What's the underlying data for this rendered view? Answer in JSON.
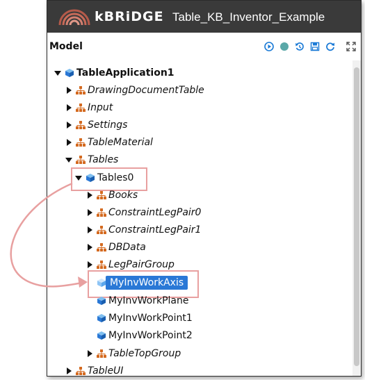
{
  "app": {
    "brand": "kBRiDGE",
    "document_title": "Table_KB_Inventor_Example"
  },
  "panel": {
    "title": "Model",
    "toolbar": [
      {
        "name": "run-icon",
        "color": "#1a7ad6"
      },
      {
        "name": "status-dot-icon",
        "color": "#5aa8a8"
      },
      {
        "name": "undo-icon",
        "color": "#1a7ad6"
      },
      {
        "name": "save-icon",
        "color": "#1a7ad6"
      },
      {
        "name": "refresh-icon",
        "color": "#1a7ad6"
      },
      {
        "name": "expand-icon",
        "color": "#555555"
      }
    ]
  },
  "tree": {
    "root": "TableApplication1",
    "items": [
      {
        "label": "DrawingDocumentTable"
      },
      {
        "label": "Input"
      },
      {
        "label": "Settings"
      },
      {
        "label": "TableMaterial"
      },
      {
        "label": "Tables"
      },
      {
        "label": "Tables0"
      },
      {
        "label": "Books"
      },
      {
        "label": "ConstraintLegPair0"
      },
      {
        "label": "ConstraintLegPair1"
      },
      {
        "label": "DBData"
      },
      {
        "label": "LegPairGroup"
      },
      {
        "label": "MyInvWorkAxis",
        "selected": true
      },
      {
        "label": "MyInvWorkPlane"
      },
      {
        "label": "MyInvWorkPoint1"
      },
      {
        "label": "MyInvWorkPoint2"
      },
      {
        "label": "TableTopGroup"
      },
      {
        "label": "TableUI"
      }
    ]
  },
  "colors": {
    "accent": "#2a78d6",
    "highlight": "#e8a0a0",
    "topbar": "#3a3a3a"
  }
}
